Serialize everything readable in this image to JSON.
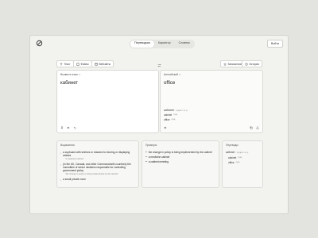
{
  "header": {
    "tabs": [
      {
        "label": "Переводчик",
        "active": true
      },
      {
        "label": "Карантор",
        "active": false
      },
      {
        "label": "Словник",
        "active": false
      }
    ],
    "login_label": "Войти"
  },
  "toolbar": {
    "text_label": "Текст",
    "files_label": "Файлы",
    "websites_label": "Вебсайты",
    "saved_label": "Записанное",
    "history_label": "История"
  },
  "source": {
    "language": "Выявить язык",
    "text": "кабинет"
  },
  "target": {
    "language": "Английский",
    "text": "office",
    "alt_word": "кабинет",
    "alt_pos": "сущест. м. р.",
    "alternatives": [
      {
        "word": "cabinet",
        "note": "сущ."
      },
      {
        "word": "office",
        "note": "сущ."
      }
    ]
  },
  "definitions": {
    "title": "Выражения",
    "items": [
      {
        "text": "a cupboard with shelves or drawers for storing or displaying articles",
        "example": "\"a medicine cabinet\""
      },
      {
        "text": "(in the UK, Canada, and other Commonwealth countries) the committee of senior ministers responsible for controlling government policy",
        "example": "\"the change in policy is being implemented by the cabinet\""
      },
      {
        "text": "a small private room",
        "example": ""
      }
    ]
  },
  "examples": {
    "title": "Примеры",
    "items": [
      "the change in policy is being implemented by the cabinet",
      "a medicine cabinet",
      "a cabinet meeting"
    ]
  },
  "translations": {
    "title": "Переводы",
    "word": "кабинет",
    "pos": "сущест. м. р.",
    "items": [
      {
        "word": "cabinet",
        "note": "сущ."
      },
      {
        "word": "office",
        "note": "сущ."
      }
    ]
  },
  "icons": [
    "logo-icon",
    "text-icon",
    "file-icon",
    "web-icon",
    "star-icon",
    "history-icon",
    "swap-icon",
    "mic-icon",
    "speaker-icon",
    "undo-icon",
    "copy-icon",
    "share-icon",
    "feedback-icon"
  ]
}
